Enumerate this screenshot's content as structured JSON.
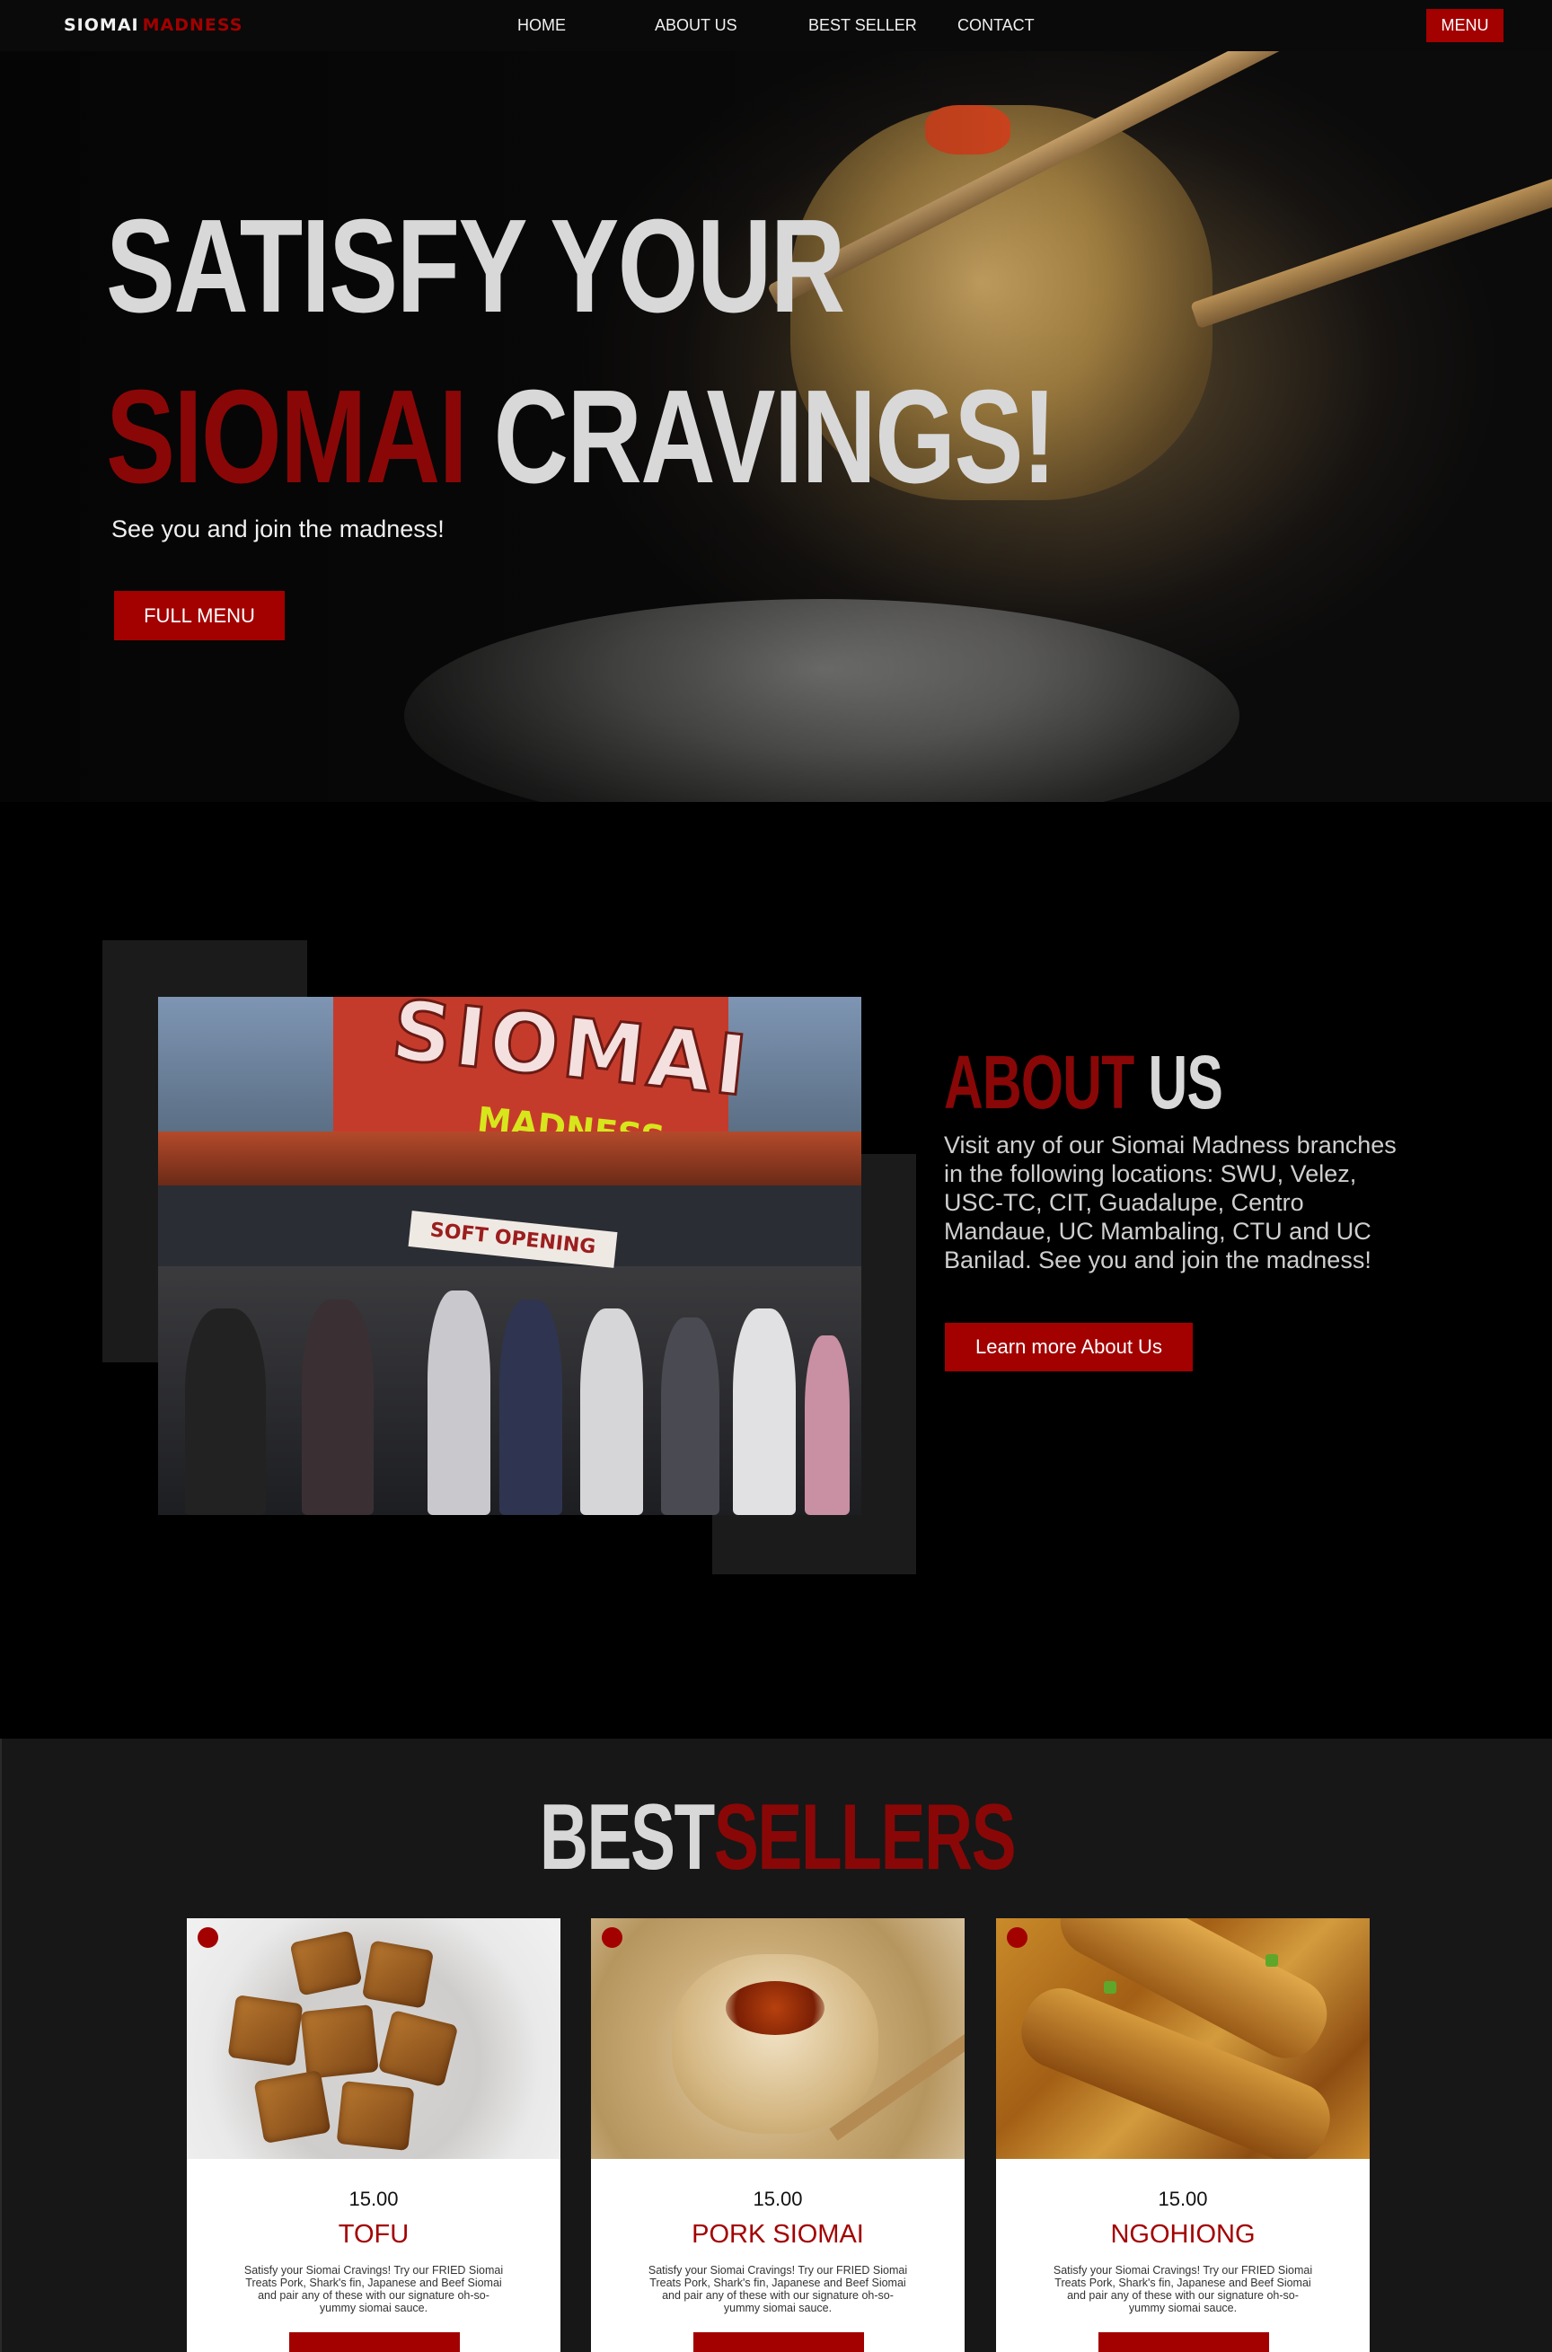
{
  "nav": {
    "logo_part1": "SIOMAI",
    "logo_part2": "MADNESS",
    "links": [
      "HOME",
      "ABOUT US",
      "BEST SELLER",
      "CONTACT"
    ],
    "menu_button": "MENU"
  },
  "hero": {
    "line1": "SATISFY YOUR",
    "line2_red": "SIOMAI",
    "line2_rest": "CRAVINGS!",
    "subtitle": "See you and join the madness!",
    "button": "FULL MENU"
  },
  "about": {
    "photo_sign": "SIOMAI",
    "photo_sign_sub": "MADNESS",
    "photo_banner": "SOFT OPENING",
    "title_red": "ABOUT",
    "title_rest": "US",
    "text": "Visit any of our Siomai Madness branches in the following locations: SWU, Velez, USC-TC, CIT, Guadalupe, Centro Mandaue, UC Mambaling, CTU and UC Banilad.   See you and join the madness!",
    "button": "Learn more About Us"
  },
  "bestsellers": {
    "title_a": "BEST",
    "title_b": "SELLERS",
    "items": [
      {
        "price": "15.00",
        "name": "TOFU",
        "desc": "Satisfy your Siomai Cravings!  Try our FRIED Siomai Treats  Pork, Shark's fin, Japanese and Beef Siomai and pair any of these with our signature oh-so-yummy siomai sauce."
      },
      {
        "price": "15.00",
        "name": "PORK SIOMAI",
        "desc": "Satisfy your Siomai Cravings!  Try our FRIED Siomai Treats  Pork, Shark's fin, Japanese and Beef Siomai and pair any of these with our signature oh-so-yummy siomai sauce."
      },
      {
        "price": "15.00",
        "name": "NGOHIONG",
        "desc": "Satisfy your Siomai Cravings!  Try our FRIED Siomai Treats  Pork, Shark's fin, Japanese and Beef Siomai and pair any of these with our signature oh-so-yummy siomai sauce."
      }
    ]
  },
  "colors": {
    "brand_red": "#a30000",
    "dark_red_text": "#8a0707",
    "background": "#000000",
    "section_gray": "#171717"
  }
}
